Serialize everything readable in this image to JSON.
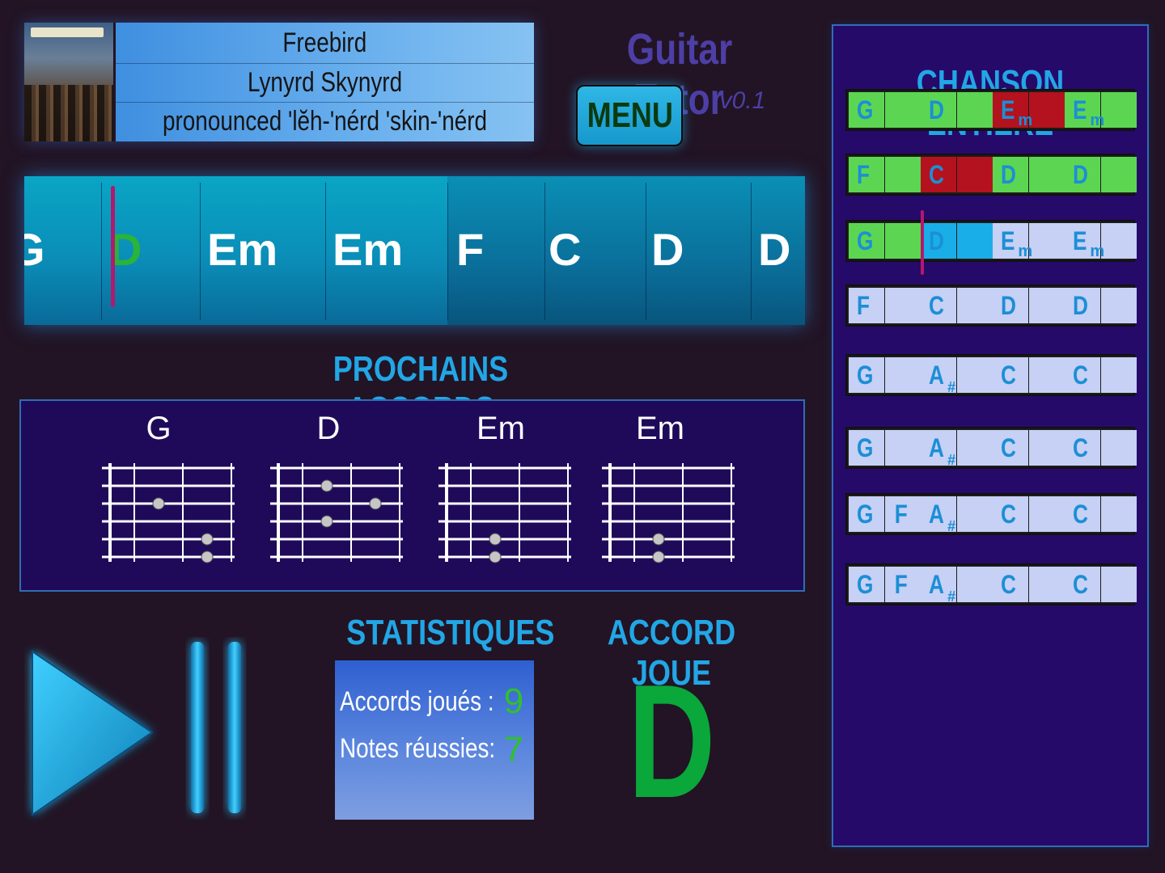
{
  "song": {
    "title": "Freebird",
    "artist": "Lynyrd Skynyrd",
    "pronunciation": "pronounced 'lĕh-'nérd 'skin-'nérd"
  },
  "app": {
    "title": "Guitar Tutor",
    "version": "v0.1",
    "menu_label": "MENU"
  },
  "timeline": {
    "chords": [
      "G",
      "D",
      "Em",
      "Em",
      "F",
      "C",
      "D",
      "D"
    ],
    "current_index": 1
  },
  "next_chords": {
    "title": "PROCHAINS ACCORDS",
    "chords": [
      {
        "name": "G",
        "dots": [
          [
            2,
            2
          ],
          [
            3,
            4
          ],
          [
            3,
            5
          ]
        ]
      },
      {
        "name": "D",
        "dots": [
          [
            2,
            1
          ],
          [
            2,
            3
          ],
          [
            3,
            2
          ]
        ]
      },
      {
        "name": "Em",
        "dots": [
          [
            2,
            4
          ],
          [
            2,
            5
          ]
        ]
      },
      {
        "name": "Em",
        "dots": [
          [
            2,
            4
          ],
          [
            2,
            5
          ]
        ]
      }
    ]
  },
  "controls": {
    "play": "play-icon",
    "pause": "pause-icon"
  },
  "stats": {
    "title": "STATISTIQUES",
    "chords_played_label": "Accords joués :",
    "chords_played": "9",
    "notes_success_label": "Notes réussies:",
    "notes_success": "7"
  },
  "played": {
    "title": "ACCORD JOUE",
    "chord": "D"
  },
  "colors": {
    "correct": "#5cd652",
    "wrong": "#b3121e",
    "current": "#1aaee8",
    "pending": "#c7d0f5"
  },
  "whole_song": {
    "title": "CHANSON ENTIERE",
    "rows": [
      [
        {
          "root": "G",
          "sfx": "",
          "state": "correct"
        },
        {
          "root": "D",
          "sfx": "",
          "state": "correct"
        },
        {
          "root": "E",
          "sfx": "m",
          "state": "wrong"
        },
        {
          "root": "E",
          "sfx": "m",
          "state": "correct"
        }
      ],
      [
        {
          "root": "F",
          "sfx": "",
          "state": "correct"
        },
        {
          "root": "C",
          "sfx": "",
          "state": "wrong"
        },
        {
          "root": "D",
          "sfx": "",
          "state": "correct"
        },
        {
          "root": "D",
          "sfx": "",
          "state": "correct"
        }
      ],
      [
        {
          "root": "G",
          "sfx": "",
          "state": "correct"
        },
        {
          "root": "D",
          "sfx": "",
          "state": "current"
        },
        {
          "root": "E",
          "sfx": "m",
          "state": "pending"
        },
        {
          "root": "E",
          "sfx": "m",
          "state": "pending"
        }
      ],
      [
        {
          "root": "F",
          "sfx": "",
          "state": "pending"
        },
        {
          "root": "C",
          "sfx": "",
          "state": "pending"
        },
        {
          "root": "D",
          "sfx": "",
          "state": "pending"
        },
        {
          "root": "D",
          "sfx": "",
          "state": "pending"
        }
      ],
      [
        {
          "root": "G",
          "sfx": "",
          "state": "pending"
        },
        {
          "root": "A",
          "sfx": "#",
          "state": "pending"
        },
        {
          "root": "C",
          "sfx": "",
          "state": "pending"
        },
        {
          "root": "C",
          "sfx": "",
          "state": "pending"
        }
      ],
      [
        {
          "root": "G",
          "sfx": "",
          "state": "pending"
        },
        {
          "root": "A",
          "sfx": "#",
          "state": "pending"
        },
        {
          "root": "C",
          "sfx": "",
          "state": "pending"
        },
        {
          "root": "C",
          "sfx": "",
          "state": "pending"
        }
      ],
      [
        {
          "root": "G",
          "extra": "F",
          "sfx": "",
          "state": "pending"
        },
        {
          "root": "A",
          "sfx": "#",
          "state": "pending"
        },
        {
          "root": "C",
          "sfx": "",
          "state": "pending"
        },
        {
          "root": "C",
          "sfx": "",
          "state": "pending"
        }
      ],
      [
        {
          "root": "G",
          "extra": "F",
          "sfx": "",
          "state": "pending"
        },
        {
          "root": "A",
          "sfx": "#",
          "state": "pending"
        },
        {
          "root": "C",
          "sfx": "",
          "state": "pending"
        },
        {
          "root": "C",
          "sfx": "",
          "state": "pending"
        }
      ]
    ]
  }
}
